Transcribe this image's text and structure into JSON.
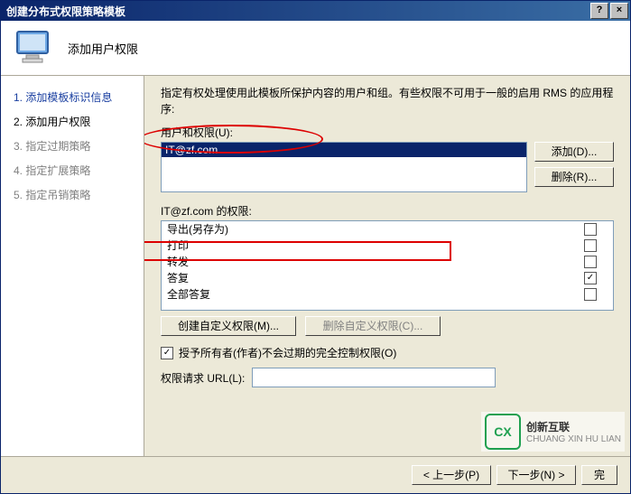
{
  "window": {
    "title": "创建分布式权限策略模板",
    "help_label": "?",
    "close_label": "×"
  },
  "header": {
    "subtitle": "添加用户权限"
  },
  "sidebar": {
    "steps": [
      {
        "num": "1.",
        "label": "添加模板标识信息",
        "state": "done"
      },
      {
        "num": "2.",
        "label": "添加用户权限",
        "state": "active"
      },
      {
        "num": "3.",
        "label": "指定过期策略",
        "state": "future"
      },
      {
        "num": "4.",
        "label": "指定扩展策略",
        "state": "future"
      },
      {
        "num": "5.",
        "label": "指定吊销策略",
        "state": "future"
      }
    ]
  },
  "content": {
    "description": "指定有权处理使用此模板所保护内容的用户和组。有些权限不可用于一般的启用 RMS 的应用程序:",
    "users_label": "用户和权限(U):",
    "users": [
      {
        "text": "IT@zf.com",
        "selected": true
      }
    ],
    "add_button": "添加(D)...",
    "remove_button": "删除(R)...",
    "perm_label_prefix": "IT@zf.com 的权限:",
    "permissions": [
      {
        "label": "导出(另存为)",
        "checked": false
      },
      {
        "label": "打印",
        "checked": false
      },
      {
        "label": "转发",
        "checked": false
      },
      {
        "label": "答复",
        "checked": true
      },
      {
        "label": "全部答复",
        "checked": false
      }
    ],
    "create_custom_btn": "创建自定义权限(M)...",
    "delete_custom_btn": "删除自定义权限(C)...",
    "grant_owner_label": "授予所有者(作者)不会过期的完全控制权限(O)",
    "grant_owner_checked": true,
    "url_label": "权限请求 URL(L):",
    "url_value": ""
  },
  "footer": {
    "prev": "< 上一步(P)",
    "next": "下一步(N) >",
    "finish": "完"
  },
  "watermark": {
    "brand_cn": "创新互联",
    "brand_py": "CHUANG XIN HU LIAN",
    "logo_text": "CX"
  }
}
